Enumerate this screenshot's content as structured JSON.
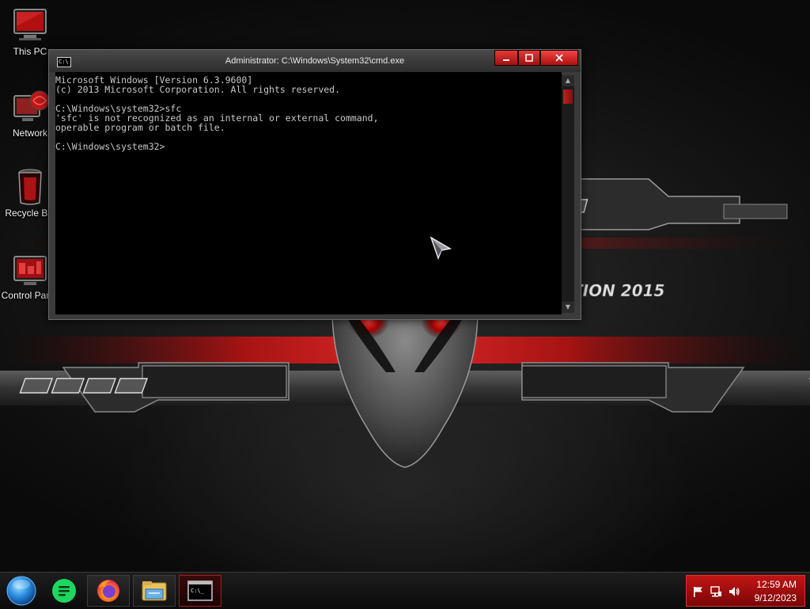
{
  "desktop": {
    "icons": [
      {
        "label": "This PC",
        "icon": "computer-icon"
      },
      {
        "label": "Network",
        "icon": "network-icon"
      },
      {
        "label": "Recycle Bin",
        "icon": "recycle-bin-icon"
      },
      {
        "label": "Control Panel",
        "icon": "control-panel-icon"
      }
    ],
    "wallpaper_text": "TION 2015"
  },
  "cmd_window": {
    "title": "Administrator: C:\\Windows\\System32\\cmd.exe",
    "icon_text": "C:\\",
    "console_text": "Microsoft Windows [Version 6.3.9600]\n(c) 2013 Microsoft Corporation. All rights reserved.\n\nC:\\Windows\\system32>sfc\n'sfc' is not recognized as an internal or external command,\noperable program or batch file.\n\nC:\\Windows\\system32>"
  },
  "taskbar": {
    "items": [
      {
        "name": "start",
        "icon": "start-orb-icon"
      },
      {
        "name": "notes",
        "icon": "notes-icon"
      },
      {
        "name": "firefox",
        "icon": "firefox-icon"
      },
      {
        "name": "file-explorer",
        "icon": "folder-icon"
      },
      {
        "name": "command-prompt",
        "icon": "cmd-icon",
        "active": true
      }
    ],
    "cmd_icon_text": "C:\\_",
    "tray": {
      "icons": [
        "action-center-flag-icon",
        "network-icon",
        "volume-icon"
      ],
      "time": "12:59 AM",
      "date": "9/12/2023"
    }
  },
  "colors": {
    "accent": "#c01515",
    "console_bg": "#000000",
    "console_text": "#c8c8c8"
  }
}
